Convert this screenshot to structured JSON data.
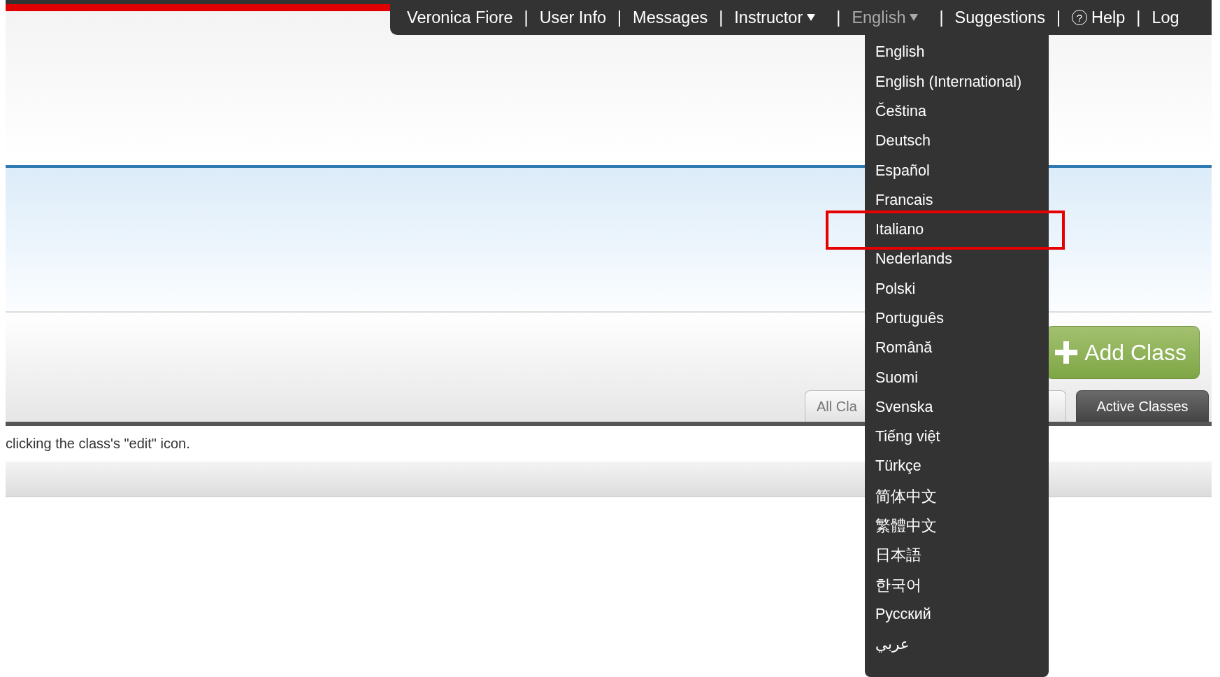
{
  "top_nav": {
    "items": [
      {
        "kind": "link",
        "label": "Veronica Fiore"
      },
      {
        "kind": "separator",
        "label": "|"
      },
      {
        "kind": "link",
        "label": "User Info"
      },
      {
        "kind": "separator",
        "label": "|"
      },
      {
        "kind": "link",
        "label": "Messages"
      },
      {
        "kind": "separator",
        "label": "|"
      },
      {
        "kind": "dropdown",
        "label": "Instructor",
        "expanded": false
      },
      {
        "kind": "separator",
        "label": "|"
      },
      {
        "kind": "dropdown",
        "label": "English",
        "expanded": true
      },
      {
        "kind": "separator",
        "label": "|"
      },
      {
        "kind": "link",
        "label": "Suggestions"
      },
      {
        "kind": "separator",
        "label": "|"
      },
      {
        "kind": "help",
        "label": "Help",
        "icon": "?"
      },
      {
        "kind": "separator",
        "label": "|"
      },
      {
        "kind": "link",
        "label": "Log"
      }
    ]
  },
  "language_menu": {
    "items": [
      {
        "label": "English",
        "highlighted": false
      },
      {
        "label": "English (International)",
        "highlighted": false
      },
      {
        "label": "Čeština",
        "highlighted": false
      },
      {
        "label": "Deutsch",
        "highlighted": false
      },
      {
        "label": "Español",
        "highlighted": false
      },
      {
        "label": "Francais",
        "highlighted": false
      },
      {
        "label": "Italiano",
        "highlighted": true
      },
      {
        "label": "Nederlands",
        "highlighted": false
      },
      {
        "label": "Polski",
        "highlighted": false
      },
      {
        "label": "Português",
        "highlighted": false
      },
      {
        "label": "Română",
        "highlighted": false
      },
      {
        "label": "Suomi",
        "highlighted": false
      },
      {
        "label": "Svenska",
        "highlighted": false
      },
      {
        "label": "Tiếng việt",
        "highlighted": false
      },
      {
        "label": "Türkçe",
        "highlighted": false
      },
      {
        "label": "简体中文",
        "highlighted": false
      },
      {
        "label": "繁體中文",
        "highlighted": false
      },
      {
        "label": "日本語",
        "highlighted": false
      },
      {
        "label": "한국어",
        "highlighted": false
      },
      {
        "label": "Русский",
        "highlighted": false
      },
      {
        "label": "عربي",
        "highlighted": false
      }
    ]
  },
  "classes_panel": {
    "add_button": "Add Class",
    "tabs": [
      {
        "label": "All Cla",
        "selected": false
      },
      {
        "label": "Active Classes",
        "selected": true
      }
    ]
  },
  "note": "clicking the class's \"edit\" icon."
}
